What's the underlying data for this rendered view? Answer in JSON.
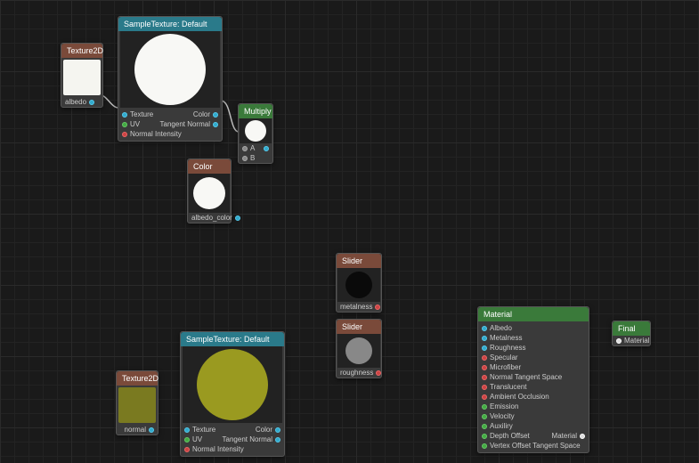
{
  "nodes": {
    "tex2d_albedo": {
      "title": "Texture2D",
      "output": "albedo"
    },
    "tex2d_normal": {
      "title": "Texture2D",
      "output": "normal"
    },
    "sample1": {
      "title": "SampleTexture: Default",
      "inputs": [
        "Texture",
        "UV",
        "Normal Intensity"
      ],
      "outputs": [
        "Color",
        "Tangent Normal"
      ]
    },
    "sample2": {
      "title": "SampleTexture: Default",
      "inputs": [
        "Texture",
        "UV",
        "Normal Intensity"
      ],
      "outputs": [
        "Color",
        "Tangent Normal"
      ]
    },
    "multiply": {
      "title": "Multiply",
      "inputs": [
        "A",
        "B"
      ]
    },
    "color": {
      "title": "Color",
      "output": "albedo_color"
    },
    "slider_metal": {
      "title": "Slider",
      "output": "metalness"
    },
    "slider_rough": {
      "title": "Slider",
      "output": "roughness"
    },
    "material": {
      "title": "Material",
      "inputs": [
        "Albedo",
        "Metalness",
        "Roughness",
        "Specular",
        "Microfiber",
        "Normal Tangent Space",
        "Translucent",
        "Ambient Occlusion",
        "Emission",
        "Velocity",
        "Auxiliry",
        "Depth Offset",
        "Vertex Offset Tangent Space"
      ],
      "output": "Material"
    },
    "final": {
      "title": "Final",
      "input": "Material"
    }
  },
  "chart_data": {
    "type": "diagram",
    "graph_type": "material-node-graph",
    "nodes": [
      {
        "id": "tex2d_albedo",
        "type": "Texture2D",
        "outputs": [
          "albedo"
        ]
      },
      {
        "id": "sample1",
        "type": "SampleTexture",
        "preset": "Default",
        "inputs": [
          "Texture",
          "UV",
          "Normal Intensity"
        ],
        "outputs": [
          "Color",
          "Tangent Normal"
        ]
      },
      {
        "id": "color",
        "type": "Color",
        "outputs": [
          "albedo_color"
        ]
      },
      {
        "id": "multiply",
        "type": "Multiply",
        "inputs": [
          "A",
          "B"
        ]
      },
      {
        "id": "slider_metal",
        "type": "Slider",
        "outputs": [
          "metalness"
        ]
      },
      {
        "id": "slider_rough",
        "type": "Slider",
        "outputs": [
          "roughness"
        ]
      },
      {
        "id": "tex2d_normal",
        "type": "Texture2D",
        "outputs": [
          "normal"
        ]
      },
      {
        "id": "sample2",
        "type": "SampleTexture",
        "preset": "Default",
        "inputs": [
          "Texture",
          "UV",
          "Normal Intensity"
        ],
        "outputs": [
          "Color",
          "Tangent Normal"
        ]
      },
      {
        "id": "material",
        "type": "Material",
        "inputs": [
          "Albedo",
          "Metalness",
          "Roughness",
          "Specular",
          "Microfiber",
          "Normal Tangent Space",
          "Translucent",
          "Ambient Occlusion",
          "Emission",
          "Velocity",
          "Auxiliry",
          "Depth Offset",
          "Vertex Offset Tangent Space"
        ],
        "outputs": [
          "Material"
        ]
      },
      {
        "id": "final",
        "type": "Final",
        "inputs": [
          "Material"
        ]
      }
    ],
    "edges": [
      {
        "from": "tex2d_albedo.albedo",
        "to": "sample1.Texture"
      },
      {
        "from": "sample1.Color",
        "to": "multiply.A"
      },
      {
        "from": "color.albedo_color",
        "to": "multiply.B"
      },
      {
        "from": "multiply.out",
        "to": "material.Albedo"
      },
      {
        "from": "slider_metal.metalness",
        "to": "material.Metalness"
      },
      {
        "from": "slider_rough.roughness",
        "to": "material.Roughness"
      },
      {
        "from": "tex2d_normal.normal",
        "to": "sample2.Texture"
      },
      {
        "from": "sample2.Tangent Normal",
        "to": "material.Normal Tangent Space"
      },
      {
        "from": "material.Material",
        "to": "final.Material"
      }
    ]
  }
}
